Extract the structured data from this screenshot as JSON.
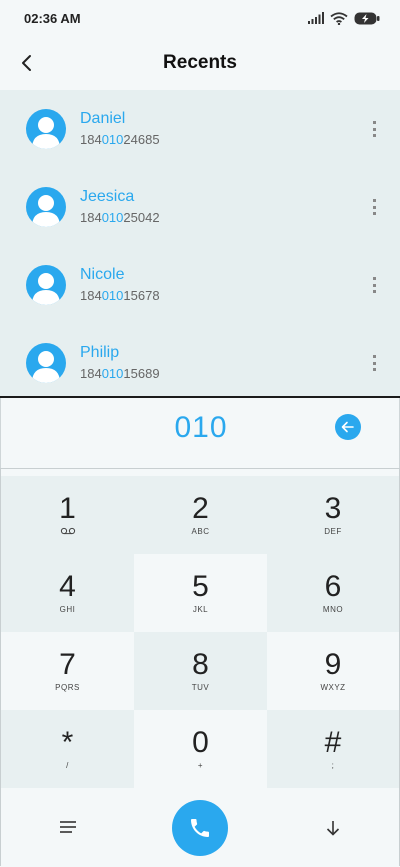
{
  "status_bar": {
    "time": "02:36 AM"
  },
  "header": {
    "title": "Recents"
  },
  "contacts": [
    {
      "name": "Daniel",
      "number_prefix": "184",
      "number_match": "010",
      "number_suffix": "24685"
    },
    {
      "name": "Jeesica",
      "number_prefix": "184",
      "number_match": "010",
      "number_suffix": "25042"
    },
    {
      "name": "Nicole",
      "number_prefix": "184",
      "number_match": "010",
      "number_suffix": "15678"
    },
    {
      "name": "Philip",
      "number_prefix": "184",
      "number_match": "010",
      "number_suffix": "15689"
    }
  ],
  "dialer": {
    "input_value": "010",
    "keys": [
      {
        "digit": "1",
        "sub": ""
      },
      {
        "digit": "2",
        "sub": "ABC"
      },
      {
        "digit": "3",
        "sub": "DEF"
      },
      {
        "digit": "4",
        "sub": "GHI"
      },
      {
        "digit": "5",
        "sub": "JKL"
      },
      {
        "digit": "6",
        "sub": "MNO"
      },
      {
        "digit": "7",
        "sub": "PQRS"
      },
      {
        "digit": "8",
        "sub": "TUV"
      },
      {
        "digit": "9",
        "sub": "WXYZ"
      },
      {
        "digit": "*",
        "sub": "/"
      },
      {
        "digit": "0",
        "sub": "+"
      },
      {
        "digit": "#",
        "sub": ";"
      }
    ]
  },
  "icons": {
    "back": "back-arrow-icon",
    "more": "more-vertical-icon",
    "backspace": "backspace-icon",
    "voicemail": "voicemail-icon",
    "menu": "menu-icon",
    "call": "phone-icon",
    "collapse": "arrow-down-icon"
  },
  "colors": {
    "accent": "#2aa8ee",
    "list_bg": "#e6eff0",
    "page_bg": "#f4f8f9"
  }
}
